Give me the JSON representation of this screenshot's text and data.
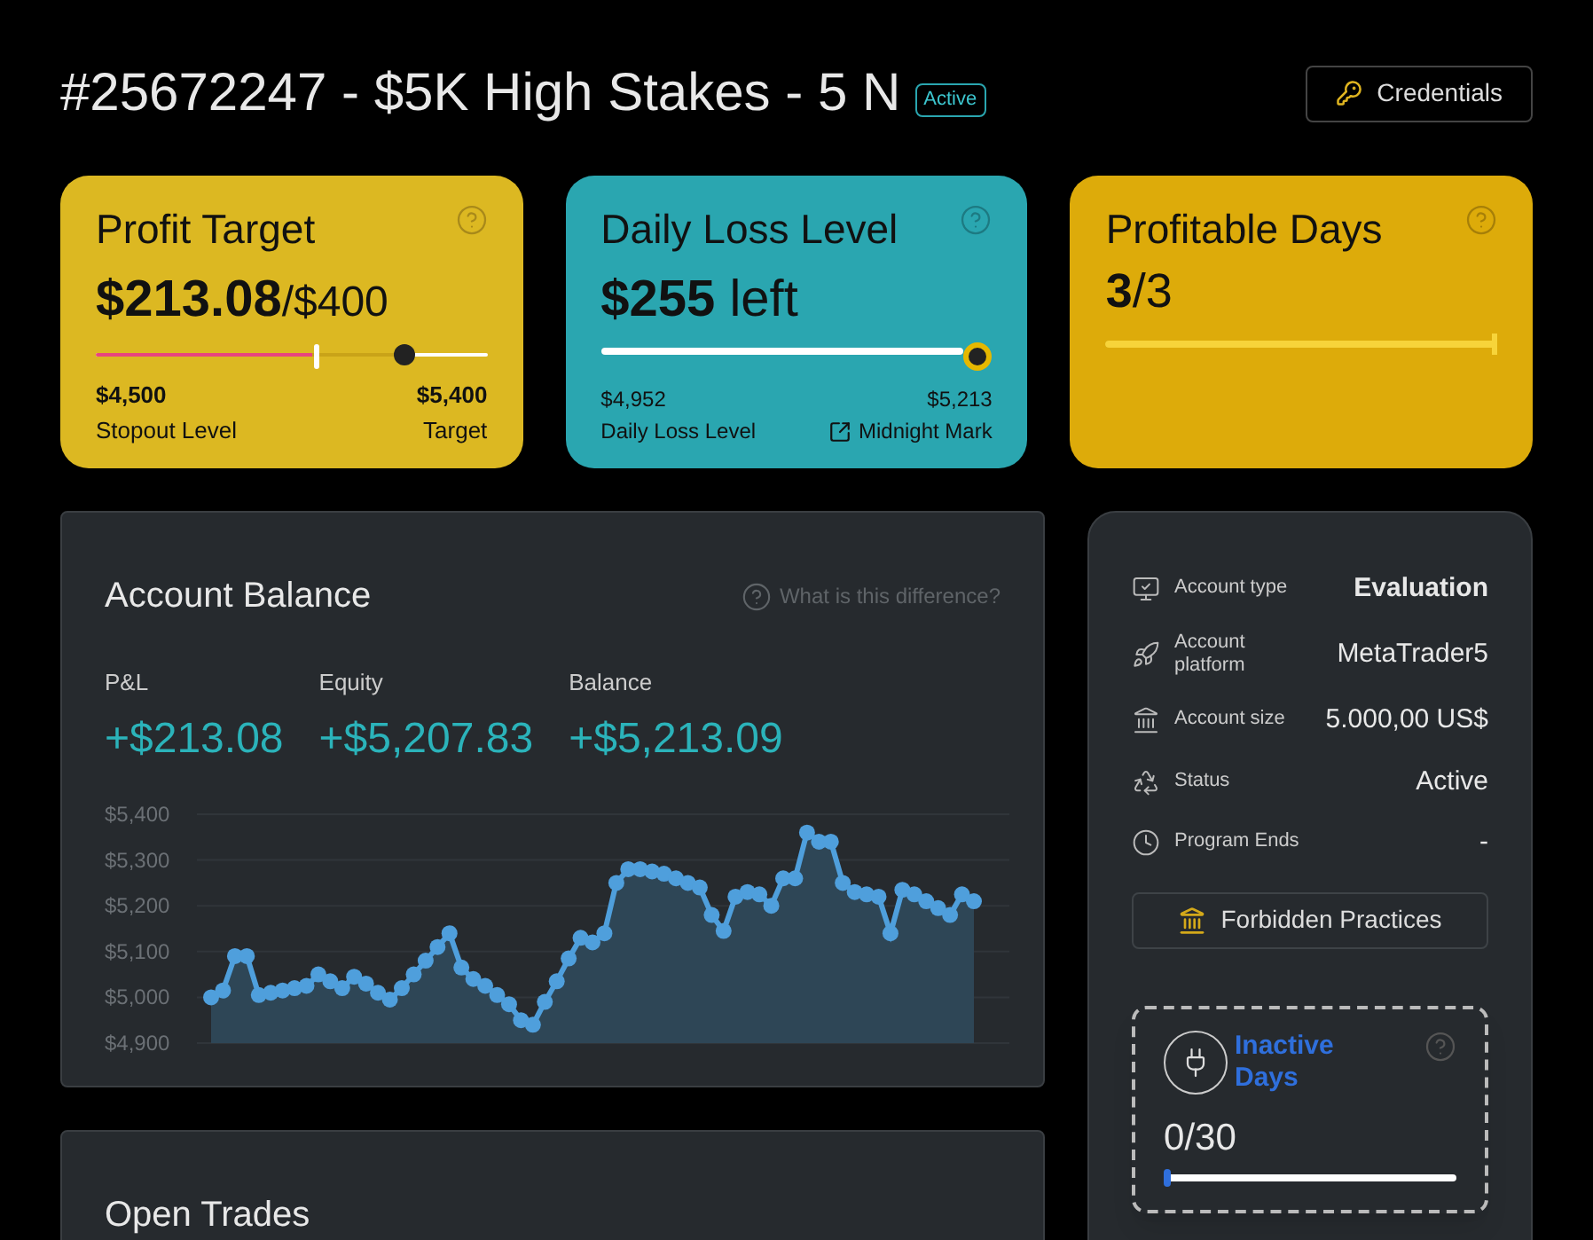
{
  "header": {
    "title": "#25672247 - $5K High Stakes - 5 N",
    "badge": "Active",
    "credentials_button": "Credentials"
  },
  "cards": [
    {
      "kind": "profit",
      "title": "Profit Target",
      "amount": "$213.08",
      "total": "/$400",
      "level": 0.79,
      "left_value": "$4,500",
      "left_label": "Stopout Level",
      "right_value": "$5,400",
      "right_label": "Target"
    },
    {
      "kind": "loss",
      "title": "Daily Loss Level",
      "amount": "$255",
      "suffix": "left",
      "level": 1,
      "left_value": "$4,952",
      "left_label": "Daily Loss Level",
      "right_value": "$5,213",
      "link": "Midnight Mark"
    },
    {
      "kind": "days",
      "title": "Profitable Days",
      "count": "3",
      "total": "/3",
      "level": 1
    }
  ],
  "balance": {
    "title": "Account Balance",
    "help_link": "What is this difference?",
    "stats": [
      {
        "label": "P&L",
        "value": "+$213.08"
      },
      {
        "label": "Equity",
        "value": "+$5,207.83"
      },
      {
        "label": "Balance",
        "value": "+$5,213.09"
      }
    ],
    "chart_data": {
      "type": "area",
      "ylim": [
        4900,
        5400
      ],
      "yticks": [
        {
          "value": 4900,
          "label": "$4,900"
        },
        {
          "value": 5000,
          "label": "$5,000"
        },
        {
          "value": 5100,
          "label": "$5,100"
        },
        {
          "value": 5200,
          "label": "$5,200"
        },
        {
          "value": 5300,
          "label": "$5,300"
        },
        {
          "value": 5400,
          "label": "$5,400"
        }
      ],
      "grid": true,
      "series": [
        {
          "color": "#4f9fdc",
          "values": [
            5000,
            5015,
            5090,
            5090,
            5005,
            5010,
            5015,
            5020,
            5025,
            5050,
            5035,
            5020,
            5045,
            5030,
            5010,
            4995,
            5020,
            5050,
            5080,
            5110,
            5140,
            5065,
            5040,
            5025,
            5005,
            4985,
            4950,
            4940,
            4990,
            5035,
            5085,
            5130,
            5120,
            5140,
            5250,
            5280,
            5280,
            5275,
            5270,
            5260,
            5250,
            5240,
            5180,
            5145,
            5220,
            5230,
            5225,
            5200,
            5260,
            5260,
            5360,
            5340,
            5340,
            5250,
            5230,
            5225,
            5220,
            5140,
            5235,
            5225,
            5210,
            5195,
            5180,
            5225,
            5210
          ]
        }
      ]
    }
  },
  "account_info": {
    "rows": [
      {
        "label": "Account type",
        "value": "Evaluation"
      },
      {
        "label": "Account platform",
        "value": "MetaTrader5"
      },
      {
        "label": "Account size",
        "value": "5.000,00 US$"
      },
      {
        "label": "Status",
        "value": "Active"
      },
      {
        "label": "Program Ends",
        "value": "-"
      }
    ],
    "forbidden_button": "Forbidden Practices"
  },
  "inactive_days": {
    "title": "Inactive Days",
    "count": "0",
    "total": "/30",
    "level": 0
  },
  "open_trades": {
    "title": "Open Trades"
  }
}
